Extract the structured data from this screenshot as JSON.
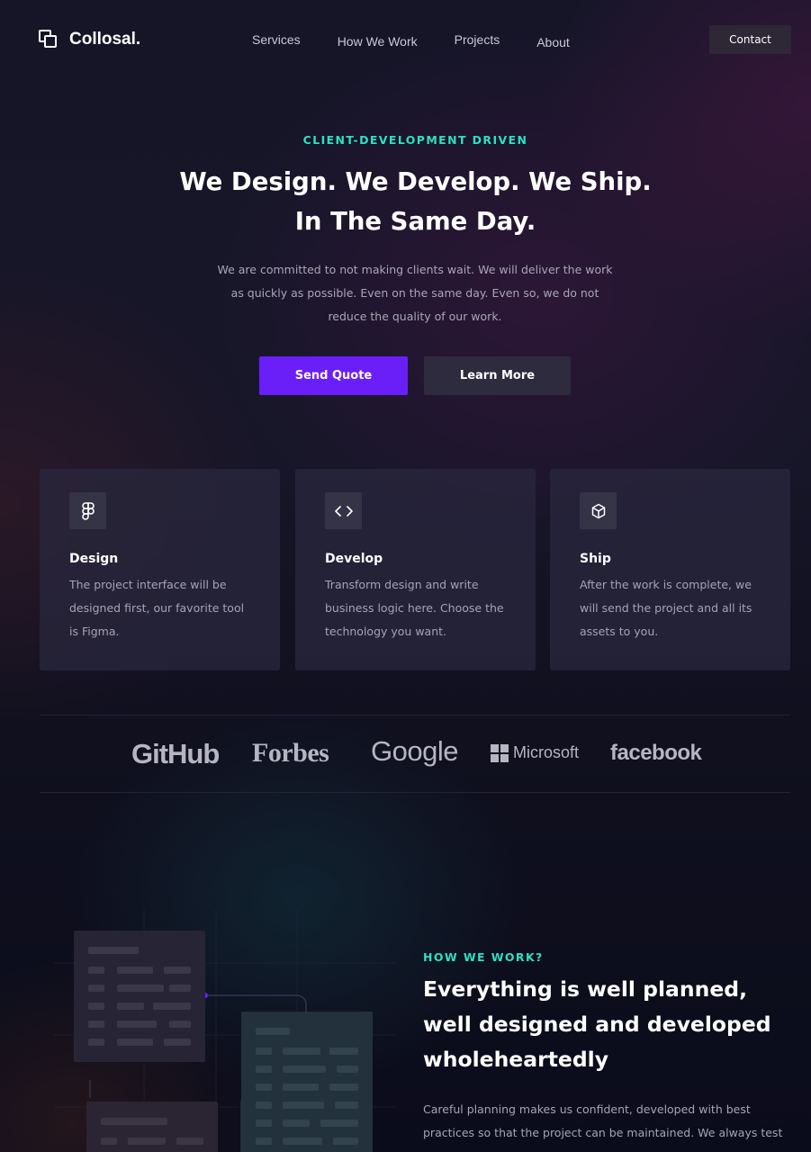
{
  "brand": {
    "name": "Collosal."
  },
  "nav": {
    "items": [
      "Services",
      "How We Work",
      "Projects",
      "About"
    ],
    "contact_label": "Contact"
  },
  "hero": {
    "eyebrow": "CLIENT-DEVELOPMENT DRIVEN",
    "title_line1": "We Design. We Develop. We Ship.",
    "title_line2": "In The Same Day.",
    "description": "We are committed to not making clients wait. We will deliver the work as quickly as possible. Even on the same day. Even so, we do not reduce the quality of our work.",
    "primary_button": "Send Quote",
    "secondary_button": "Learn More"
  },
  "cards": [
    {
      "icon": "figma-icon",
      "title": "Design",
      "text": "The project interface will be designed first, our favorite tool is Figma."
    },
    {
      "icon": "code-icon",
      "title": "Develop",
      "text": "Transform design and write business logic here. Choose the technology you want."
    },
    {
      "icon": "box-icon",
      "title": "Ship",
      "text": "After the work is complete, we will send the project and all its assets to you."
    }
  ],
  "logos": [
    "GitHub",
    "Forbes",
    "Google",
    "Microsoft",
    "facebook"
  ],
  "how": {
    "eyebrow": "HOW WE WORK?",
    "title": "Everything is well planned, well designed and developed wholeheartedly",
    "text": "Careful planning makes us confident, developed with best practices so that the project can be maintained. We always test"
  },
  "colors": {
    "accent_primary": "#6a1ff8",
    "accent_teal": "#2ee0c4",
    "background": "#0c0d1c"
  }
}
